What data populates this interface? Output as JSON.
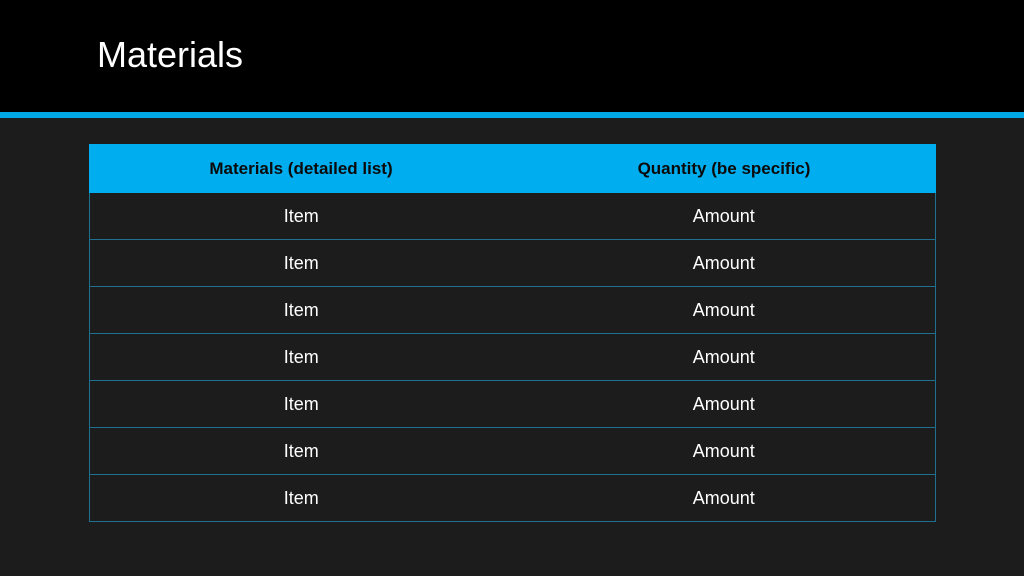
{
  "slide": {
    "title": "Materials"
  },
  "colors": {
    "title_bar": "#000000",
    "accent": "#00a8e6",
    "header_fill": "#00adee",
    "background": "#1c1c1c",
    "row_border": "#1f6f8e"
  },
  "table": {
    "headers": [
      "Materials (detailed list)",
      "Quantity (be specific)"
    ],
    "rows": [
      [
        "Item",
        "Amount"
      ],
      [
        "Item",
        "Amount"
      ],
      [
        "Item",
        "Amount"
      ],
      [
        "Item",
        "Amount"
      ],
      [
        "Item",
        "Amount"
      ],
      [
        "Item",
        "Amount"
      ],
      [
        "Item",
        "Amount"
      ]
    ]
  }
}
